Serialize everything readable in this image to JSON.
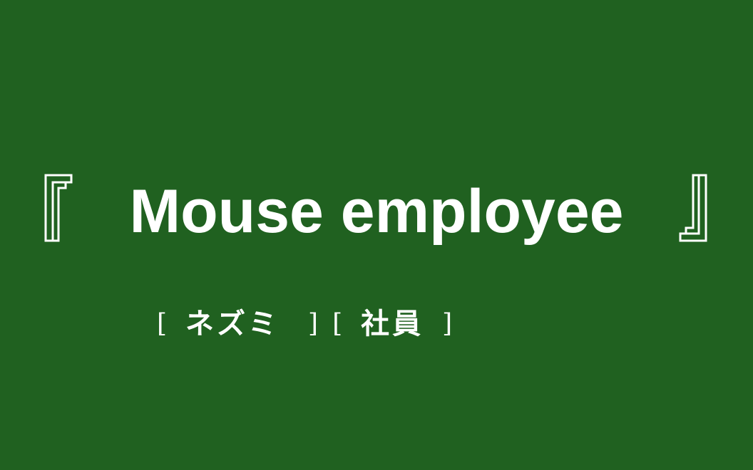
{
  "main": {
    "open_bracket_icon": "white-corner-bracket-open-icon",
    "title": "Mouse employee",
    "close_bracket_icon": "white-corner-bracket-close-icon",
    "subtitle": {
      "left_bracket_1": "[",
      "word_1": "ネズミ",
      "right_bracket_1": "]",
      "left_bracket_2": "[",
      "word_2": "社員",
      "right_bracket_2": "]"
    }
  },
  "colors": {
    "background": "#206120",
    "text": "#ffffff"
  }
}
